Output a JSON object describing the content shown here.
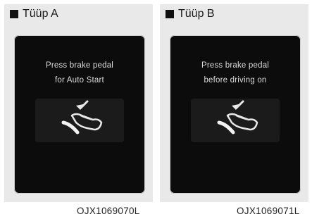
{
  "panels": [
    {
      "title": "Tüüp A",
      "message": [
        "Press brake pedal",
        "for Auto Start"
      ],
      "code": "OJX1069070L",
      "icon": "brake-pedal-foot-icon"
    },
    {
      "title": "Tüüp B",
      "message": [
        "Press brake pedal",
        "before driving on"
      ],
      "code": "OJX1069071L",
      "icon": "brake-pedal-foot-icon"
    }
  ],
  "colors": {
    "screen": "#0c0c0c",
    "text": "#dcdcdc",
    "panel": "#e9e9e9"
  }
}
